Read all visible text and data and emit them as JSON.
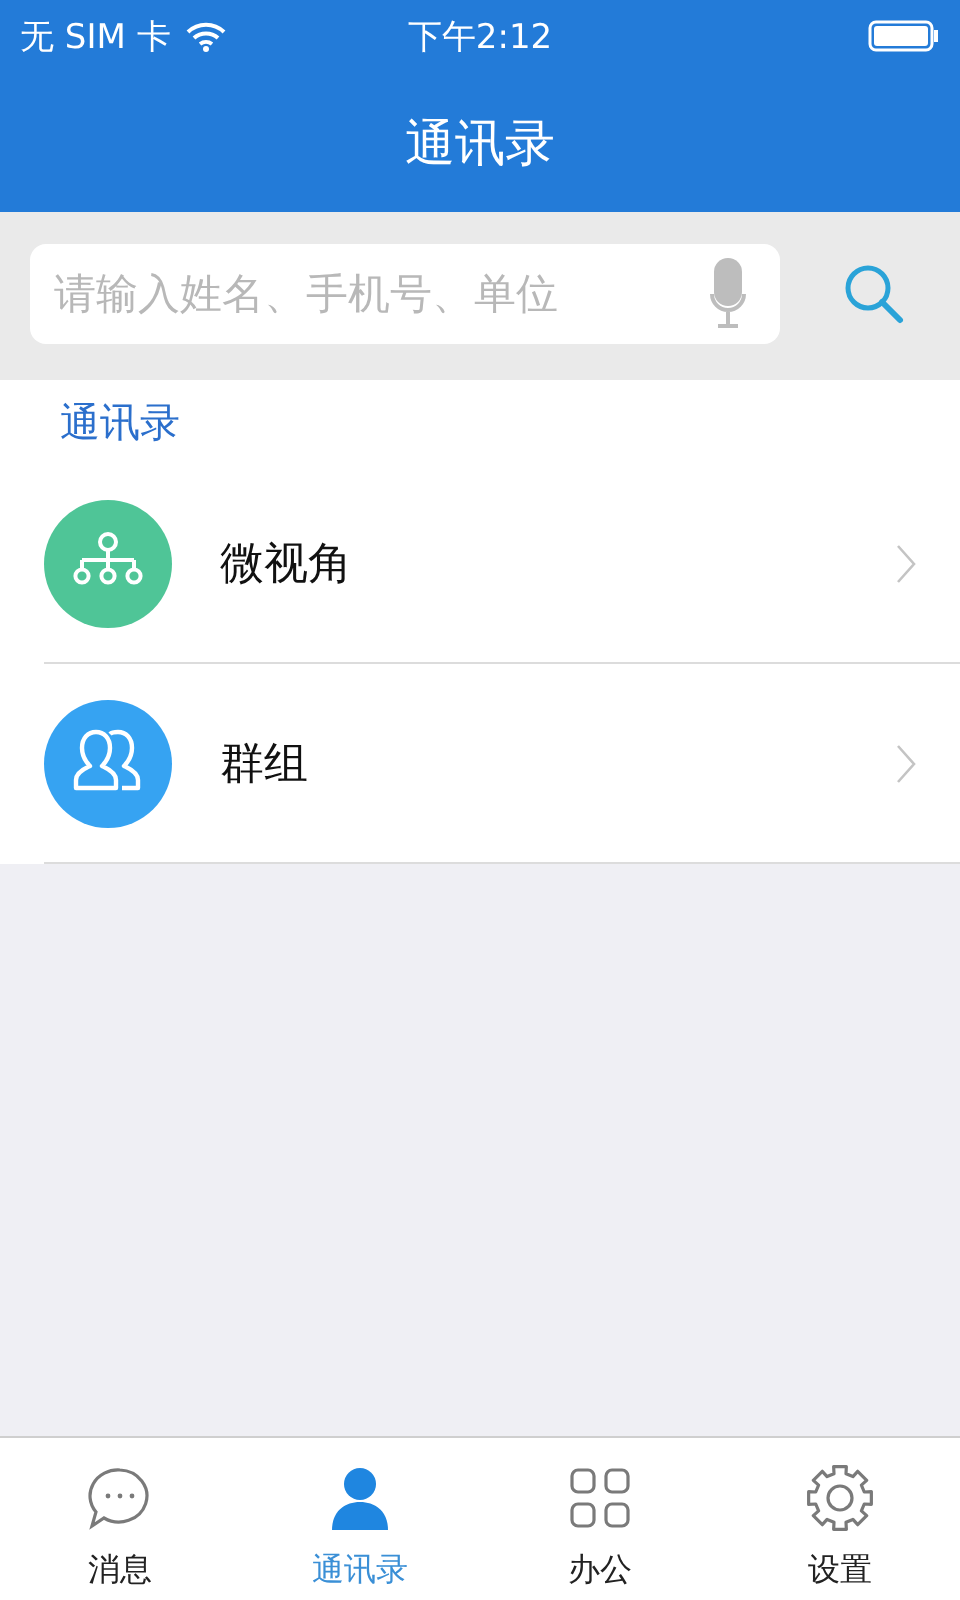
{
  "status_bar": {
    "carrier": "无 SIM 卡",
    "time": "下午2:12"
  },
  "nav_bar": {
    "title": "通讯录"
  },
  "search": {
    "placeholder": "请输入姓名、手机号、单位"
  },
  "section": {
    "title": "通讯录"
  },
  "rows": [
    {
      "label": "微视角",
      "kind": "org",
      "color": "#4fc597"
    },
    {
      "label": "群组",
      "kind": "group",
      "color": "#36a3f2"
    }
  ],
  "tabs": [
    {
      "label": "消息",
      "kind": "chat",
      "selected": false
    },
    {
      "label": "通讯录",
      "kind": "person",
      "selected": true
    },
    {
      "label": "办公",
      "kind": "grid",
      "selected": false
    },
    {
      "label": "设置",
      "kind": "gear",
      "selected": false
    }
  ]
}
